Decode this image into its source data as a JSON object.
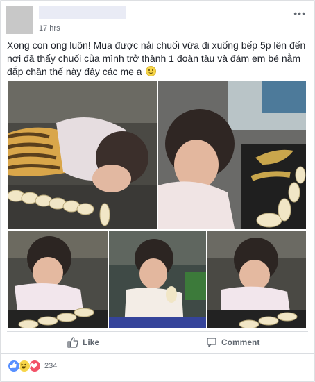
{
  "post": {
    "time": "17 hrs",
    "menu": "•••",
    "text": "Xong con ong luôn! Mua được nải chuối vừa đi xuống bếp 5p lên đến nơi đã thấy chuối của mình trở thành 1 đoàn tàu và đám em bé nằm đắp chăn thế này đây các mẹ ạ",
    "emoji_icon": "smile-emoji"
  },
  "photos": [
    {
      "subject": "child-lying-with-banana-train",
      "icon": "photo"
    },
    {
      "subject": "child-with-bananas-on-table",
      "icon": "photo"
    },
    {
      "subject": "child-arranging-bananas",
      "icon": "photo"
    },
    {
      "subject": "child-eating-banana",
      "icon": "photo"
    },
    {
      "subject": "child-with-banana-row",
      "icon": "photo"
    }
  ],
  "actions": {
    "like_label": "Like",
    "comment_label": "Comment",
    "like_icon": "thumbs-up-icon",
    "comment_icon": "comment-bubble-icon"
  },
  "reactions": {
    "types": [
      "like",
      "haha",
      "love"
    ],
    "count": "234"
  },
  "colors": {
    "like_blue": "#5890ff",
    "haha_yellow": "#f7d548",
    "love_red": "#f25268",
    "muted_text": "#606770"
  }
}
